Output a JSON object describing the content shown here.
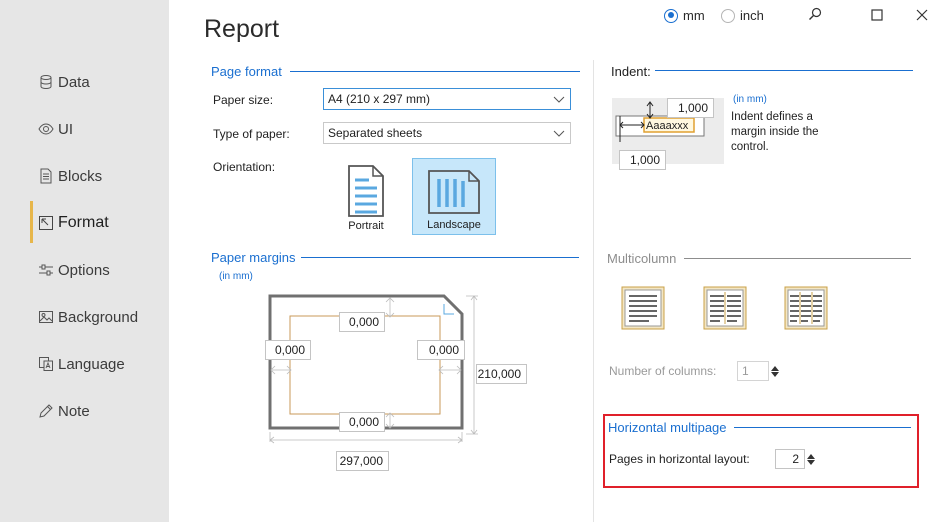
{
  "sidebar": {
    "items": [
      {
        "label": "Data",
        "icon": "database-icon"
      },
      {
        "label": "UI",
        "icon": "eye-icon"
      },
      {
        "label": "Blocks",
        "icon": "document-icon"
      },
      {
        "label": "Format",
        "icon": "format-icon",
        "active": true
      },
      {
        "label": "Options",
        "icon": "sliders-icon"
      },
      {
        "label": "Background",
        "icon": "image-icon"
      },
      {
        "label": "Language",
        "icon": "language-icon"
      },
      {
        "label": "Note",
        "icon": "pencil-icon"
      }
    ]
  },
  "header": {
    "title": "Report",
    "units": {
      "mm": "mm",
      "inch": "inch",
      "selected": "mm"
    }
  },
  "page_format": {
    "title": "Page format",
    "paper_size_label": "Paper size:",
    "paper_size_value": "A4 (210 x 297 mm)",
    "paper_type_label": "Type of paper:",
    "paper_type_value": "Separated sheets",
    "orientation_label": "Orientation:",
    "portrait_label": "Portrait",
    "landscape_label": "Landscape",
    "selected_orientation": "Landscape"
  },
  "paper_margins": {
    "title": "Paper margins",
    "unit_note": "(in mm)",
    "top": "0,000",
    "left": "0,000",
    "right": "0,000",
    "bottom": "0,000",
    "height": "210,000",
    "width": "297,000"
  },
  "indent": {
    "title": "Indent:",
    "top": "1,000",
    "left": "1,000",
    "sample_text": "Aaaaxxx",
    "unit_note": "(in mm)",
    "description": "Indent defines a margin inside the control."
  },
  "multicolumn": {
    "title": "Multicolumn",
    "columns_label": "Number of columns:",
    "columns_value": "1"
  },
  "horizontal_multipage": {
    "title": "Horizontal multipage",
    "pages_label": "Pages in horizontal layout:",
    "pages_value": "2"
  },
  "colors": {
    "accent": "#1a6fd0",
    "sidebar_bg": "#e6e6e6",
    "active_bar": "#e7b64a",
    "highlight": "#e0202a",
    "selected_bg": "#c7e7fa"
  }
}
